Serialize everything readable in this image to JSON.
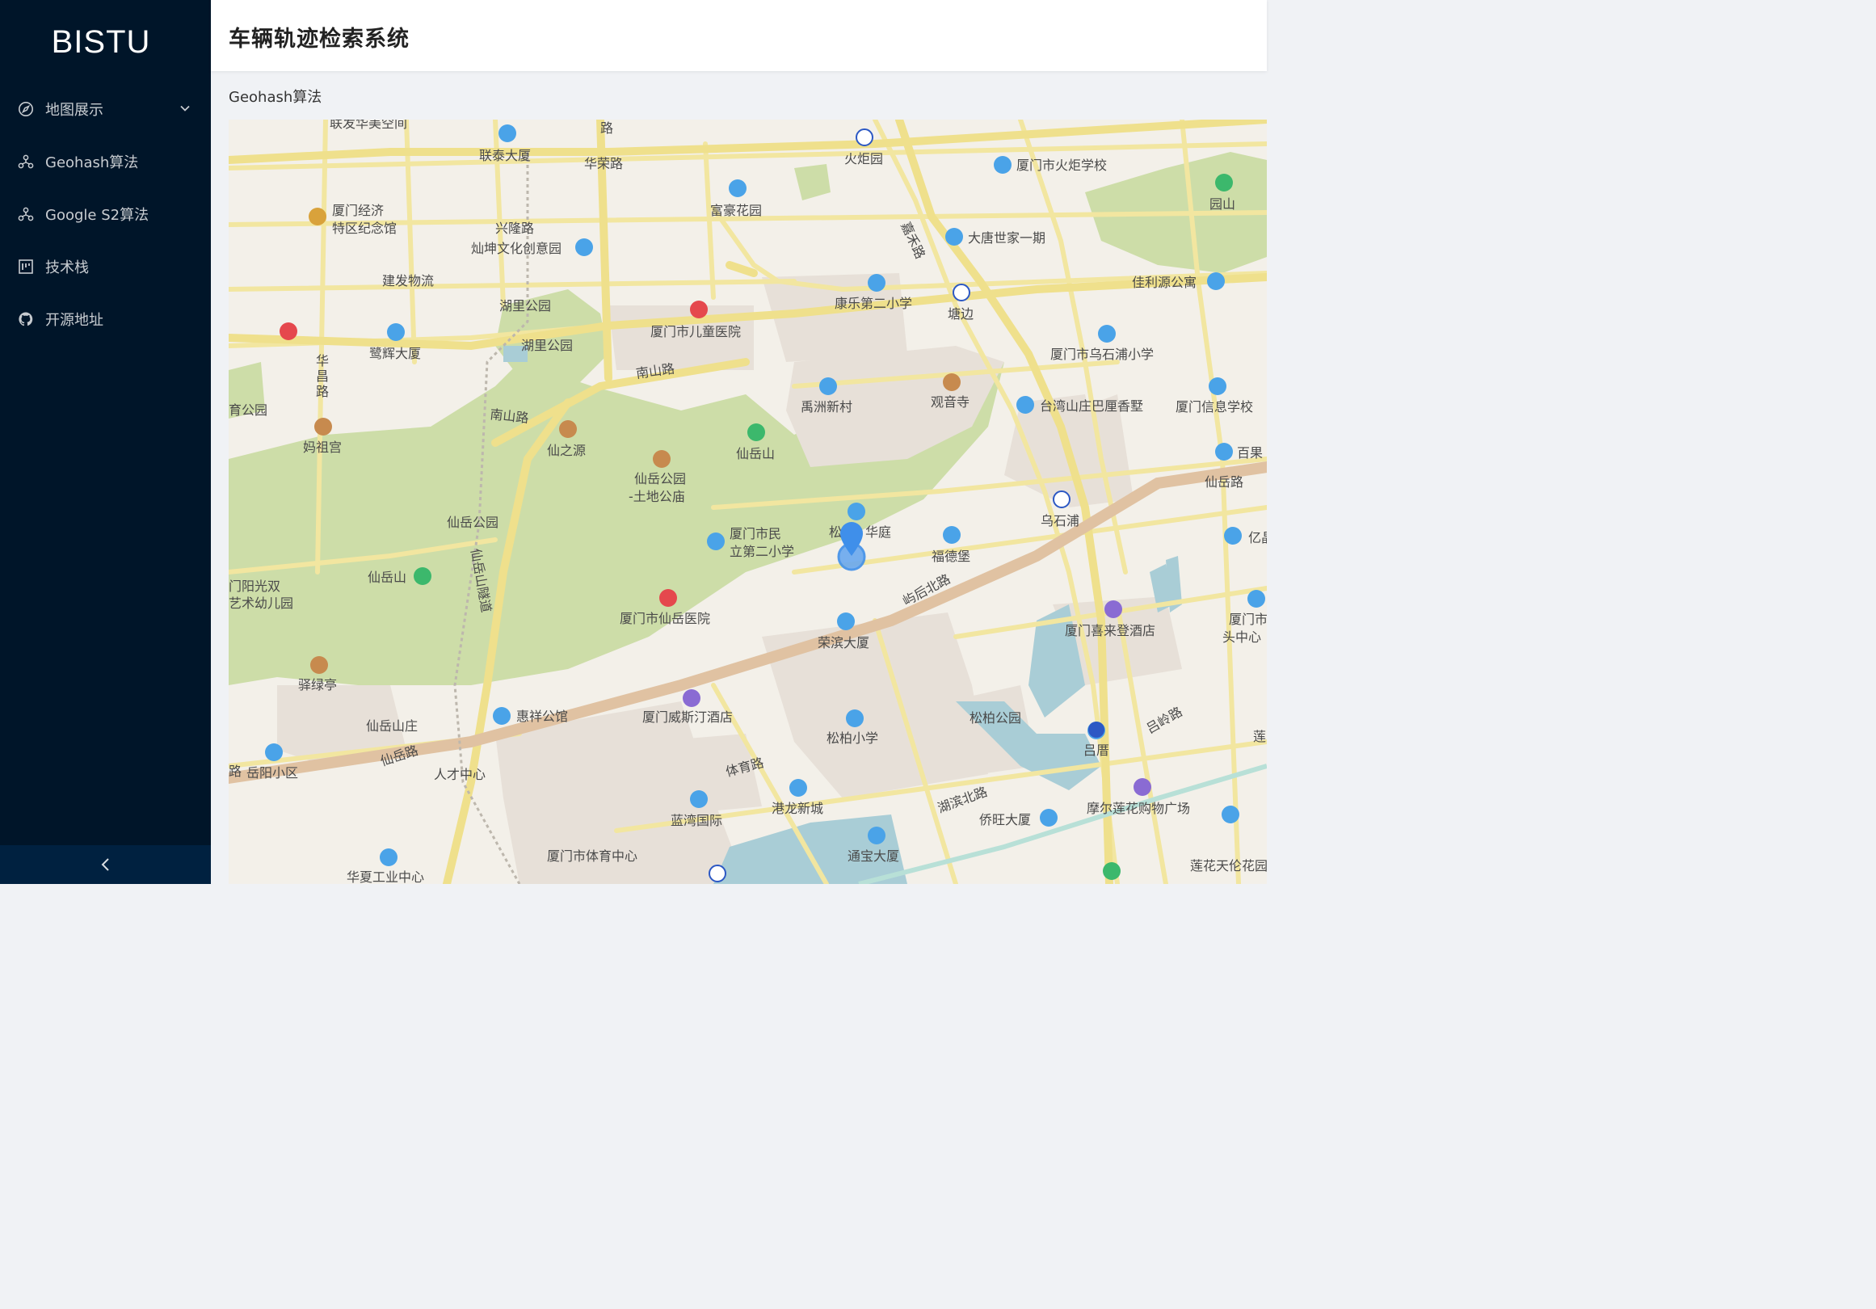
{
  "sidebar": {
    "logo": "BISTU",
    "items": [
      {
        "label": "地图展示",
        "icon": "compass-icon",
        "has_submenu": true
      },
      {
        "label": "Geohash算法",
        "icon": "deployment-unit-icon"
      },
      {
        "label": "Google S2算法",
        "icon": "deployment-unit-icon"
      },
      {
        "label": "技术栈",
        "icon": "project-icon"
      },
      {
        "label": "开源地址",
        "icon": "github-icon"
      }
    ],
    "collapse_glyph": "<"
  },
  "header": {
    "title": "车辆轨迹检索系统"
  },
  "page": {
    "subtitle": "Geohash算法"
  },
  "map": {
    "labels": [
      "联发华美空间",
      "路",
      "联泰大厦",
      "华荣路",
      "火炬园",
      "厦门市火炬学校",
      "园山",
      "富豪花园",
      "嘉禾路",
      "大唐世家一期",
      "厦门经济",
      "特区纪念馆",
      "兴隆路",
      "灿坤文化创意园",
      "建发物流",
      "湖里公园",
      "湖里公园",
      "厦门市儿童医院",
      "康乐第二小学",
      "塘边",
      "佳利源公寓",
      "鹭辉大厦",
      "华",
      "昌",
      "路",
      "南山路",
      "厦门市乌石浦小学",
      "禹洲新村",
      "观音寺",
      "台湾山庄巴厘香墅",
      "厦门信息学校",
      "育公园",
      "妈祖宫",
      "南山路",
      "仙之源",
      "仙岳山",
      "仙岳公园",
      "-土地公庙",
      "百果",
      "仙岳路",
      "乌石浦",
      "仙岳公园",
      "厦门市民",
      "立第二小学",
      "松",
      "华庭",
      "福德堡",
      "亿晶",
      "仙岳山",
      "门阳光双",
      "艺术幼儿园",
      "仙岳山隧道",
      "屿后北路",
      "厦门市仙岳医院",
      "荣滨大厦",
      "厦门喜来登酒店",
      "厦门市",
      "头中心",
      "驿绿亭",
      "惠祥公馆",
      "厦门威斯汀酒店",
      "松柏公园",
      "吕岭路",
      "仙岳山庄",
      "松柏小学",
      "吕厝",
      "仙岳路",
      "人才中心",
      "体育路",
      "路",
      "岳阳小区",
      "港龙新城",
      "湖滨北路",
      "摩尔莲花购物广场",
      "蓝湾国际",
      "侨旺大厦",
      "厦门市体育中心",
      "通宝大厦",
      "华夏工业中心",
      "莲花天伦花园",
      "莲"
    ],
    "marker": "location-pin"
  },
  "colors": {
    "sider_bg": "#001529",
    "header_bg": "#ffffff",
    "map_bg": "#f3f0e9",
    "park": "#c9dba3",
    "road": "#f4e9a5",
    "arterial": "#e3c8a8",
    "marker": "#3f8fea"
  }
}
